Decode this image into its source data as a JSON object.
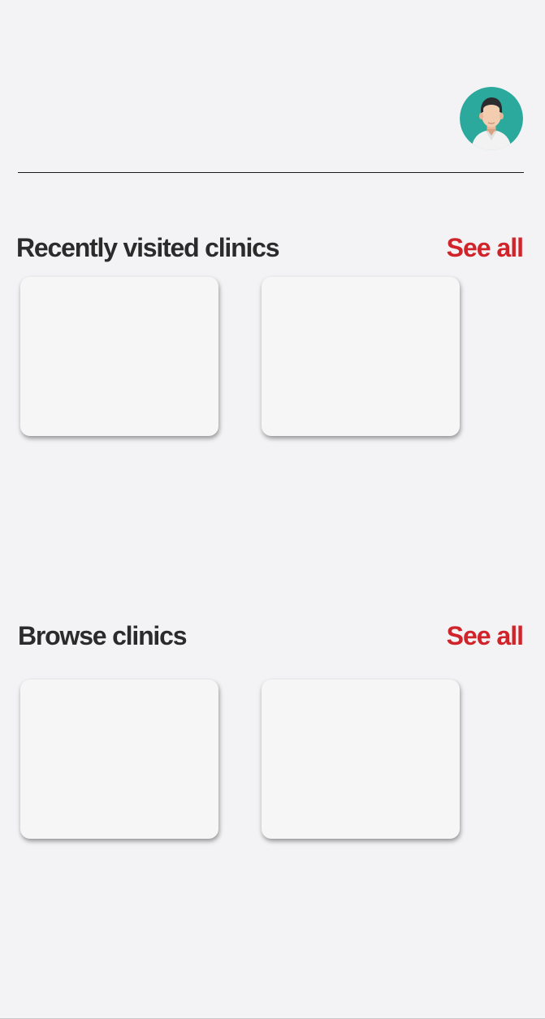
{
  "header": {
    "avatar_icon": "user-avatar-icon"
  },
  "sections": [
    {
      "title": "Recently visited clinics",
      "see_all_label": "See all",
      "cards": [
        {},
        {}
      ]
    },
    {
      "title": "Browse clinics",
      "see_all_label": "See all",
      "cards": [
        {},
        {}
      ]
    }
  ],
  "colors": {
    "background": "#f3f3f5",
    "accent": "#d0232a",
    "heading": "#2b2b2b",
    "avatar_bg": "#2aa99c"
  }
}
